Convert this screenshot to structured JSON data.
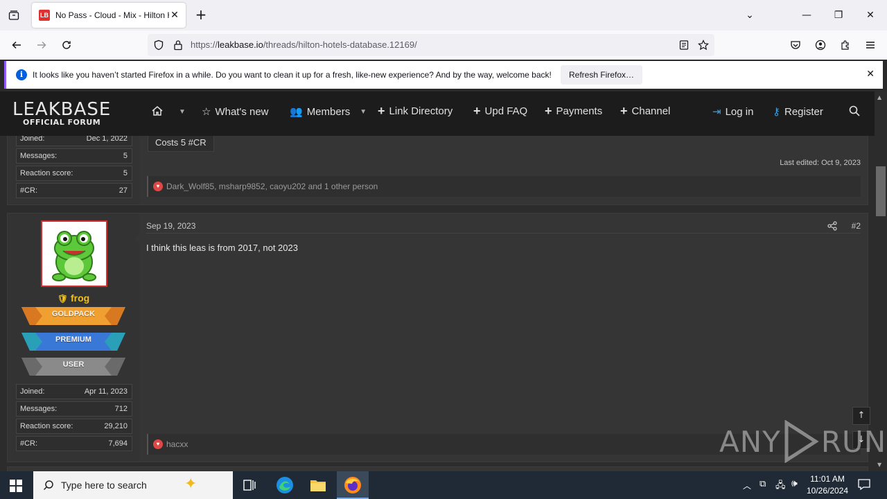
{
  "browser": {
    "tab_title": "No Pass - Cloud - Mix - Hilton Hotels Database",
    "favicon_text": "LB",
    "url_prefix": "https://",
    "url_domain": "leakbase.io",
    "url_path": "/threads/hilton-hotels-database.12169/"
  },
  "notification": {
    "message": "It looks like you haven’t started Firefox in a while. Do you want to clean it up for a fresh, like-new experience? And by the way, welcome back!",
    "button": "Refresh Firefox…"
  },
  "site": {
    "logo_main": "LEAKBASE",
    "logo_sub": "OFFICIAL FORUM",
    "nav": {
      "whats_new": "What's new",
      "members": "Members",
      "link_directory": "Link Directory",
      "upd_faq": "Upd FAQ",
      "payments": "Payments",
      "channel": "Channel",
      "login": "Log in",
      "register": "Register"
    }
  },
  "post1": {
    "stats": [
      {
        "k": "Joined:",
        "v": "Dec 1, 2022"
      },
      {
        "k": "Messages:",
        "v": "5"
      },
      {
        "k": "Reaction score:",
        "v": "5"
      },
      {
        "k": "#CR:",
        "v": "27"
      }
    ],
    "code": "Costs 5 #CR",
    "last_edited": "Last edited: Oct 9, 2023",
    "reactions": "Dark_Wolf85, msharp9852, caoyu202 and 1 other person"
  },
  "post2": {
    "username": "frog",
    "ranks": [
      "GOLDPACK",
      "PREMIUM",
      "USER"
    ],
    "stats": [
      {
        "k": "Joined:",
        "v": "Apr 11, 2023"
      },
      {
        "k": "Messages:",
        "v": "712"
      },
      {
        "k": "Reaction score:",
        "v": "29,210"
      },
      {
        "k": "#CR:",
        "v": "7,694"
      }
    ],
    "date": "Sep 19, 2023",
    "number": "#2",
    "body": "I think this leas is from 2017, not 2023",
    "reactions": "hacxx"
  },
  "taskbar": {
    "search_placeholder": "Type here to search",
    "time": "11:01 AM",
    "date": "10/26/2024"
  },
  "watermark": {
    "left": "ANY",
    "right": "RUN"
  },
  "colors": {
    "gold": "#f0a030",
    "premium": "#3a78d8",
    "user": "#8a8a8a",
    "accent": "#3aa0e0",
    "heart": "#e04848"
  }
}
